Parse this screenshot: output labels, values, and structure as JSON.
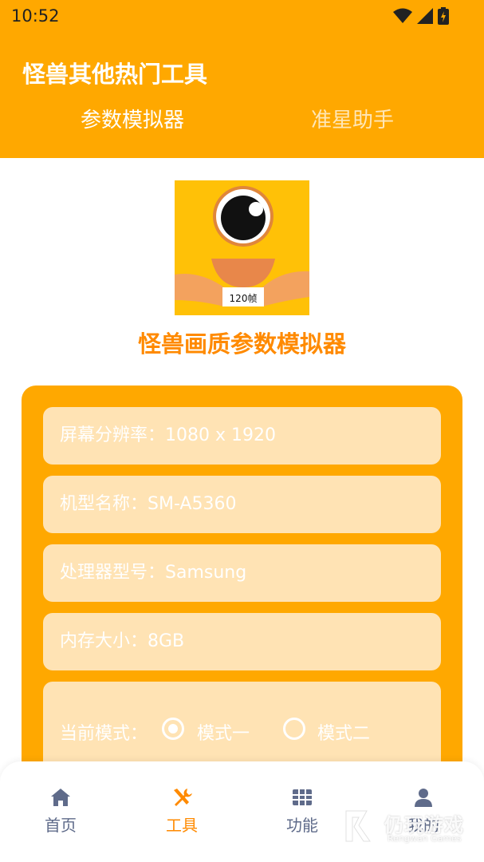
{
  "status": {
    "time": "10:52"
  },
  "header": {
    "title": "怪兽其他热门工具",
    "tabs": [
      {
        "label": "参数模拟器",
        "active": true
      },
      {
        "label": "准星助手",
        "active": false
      }
    ]
  },
  "logo": {
    "badge": "120帧"
  },
  "tool": {
    "title": "怪兽画质参数模拟器"
  },
  "card": {
    "fields": [
      "屏幕分辨率：1080 x 1920",
      "机型名称：SM-A5360",
      "处理器型号：Samsung",
      "内存大小：8GB"
    ],
    "mode": {
      "label": "当前模式：",
      "options": [
        "模式一",
        "模式二"
      ],
      "selected_index": 0
    }
  },
  "bottom_nav": {
    "items": [
      {
        "label": "首页",
        "icon": "home-icon"
      },
      {
        "label": "工具",
        "icon": "tools-icon",
        "active": true
      },
      {
        "label": "功能",
        "icon": "grid-icon"
      },
      {
        "label": "我的",
        "icon": "user-icon"
      }
    ]
  },
  "watermark": {
    "text": "仍玩游戏",
    "sub": "Rengwan Games"
  },
  "colors": {
    "accent": "#FFA800",
    "title_orange": "#FF8A00",
    "field_bg": "#FFE3B4",
    "nav_inactive": "#5F6B8A"
  }
}
